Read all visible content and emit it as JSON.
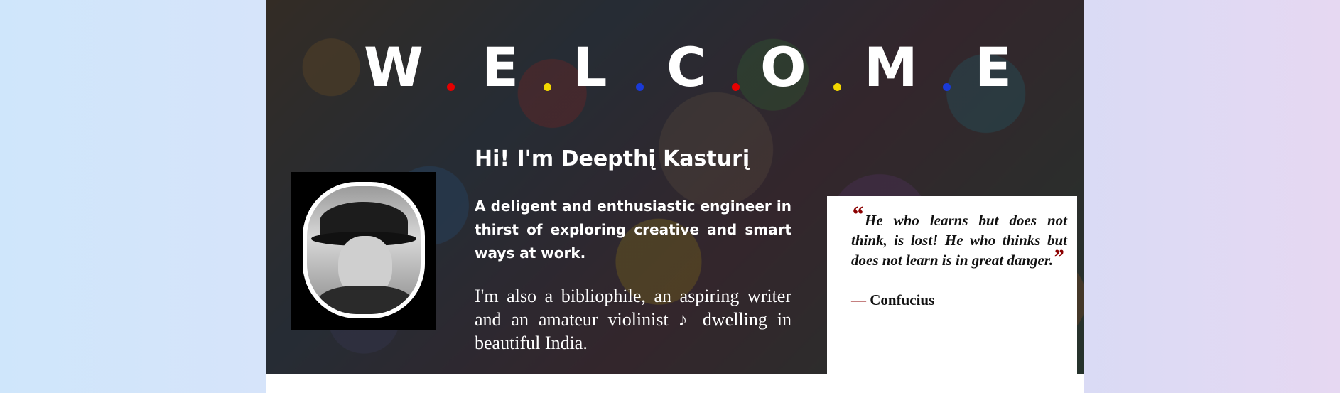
{
  "welcome": {
    "letters": [
      "W",
      "E",
      "L",
      "C",
      "O",
      "M",
      "E"
    ],
    "dot_colors": [
      "#e60000",
      "#f2d600",
      "#1a3ad8",
      "#e60000",
      "#f2d600",
      "#1a3ad8"
    ]
  },
  "profile": {
    "greeting": "Hi! I'm Deepthį Kasturį",
    "intro": "A deligent and enthusiastic engineer in thirst of exploring creative and smart ways at work.",
    "hobbies": "I'm also a bibliophile, an aspiring writer and an amateur violinist ♪ dwelling in beautiful India."
  },
  "quote": {
    "open_mark": "“",
    "text": "He who learns but does not think, is lost! He who thinks but does not learn is in great danger.",
    "close_mark": "”",
    "dash": "—",
    "author": "Confucius"
  },
  "colors": {
    "quote_accent": "#8b0000",
    "text_on_hero": "#ffffff"
  }
}
